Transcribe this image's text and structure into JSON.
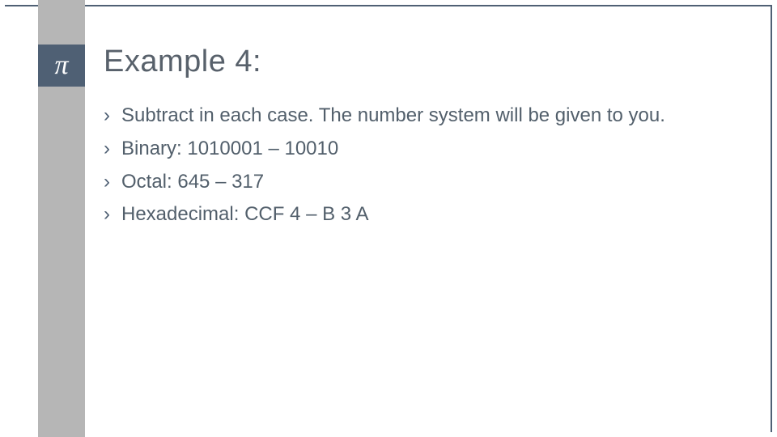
{
  "icon": {
    "glyph": "π",
    "name": "pi-icon"
  },
  "title": "Example 4:",
  "bullets": [
    "Subtract in each case. The number system will be given to you.",
    "Binary: 1010001 – 10010",
    "Octal: 645 – 317",
    "Hexadecimal: CCF 4 – B 3 A"
  ],
  "colors": {
    "accent": "#4f6074",
    "spine": "#b6b6b6",
    "text": "#525f6b"
  }
}
